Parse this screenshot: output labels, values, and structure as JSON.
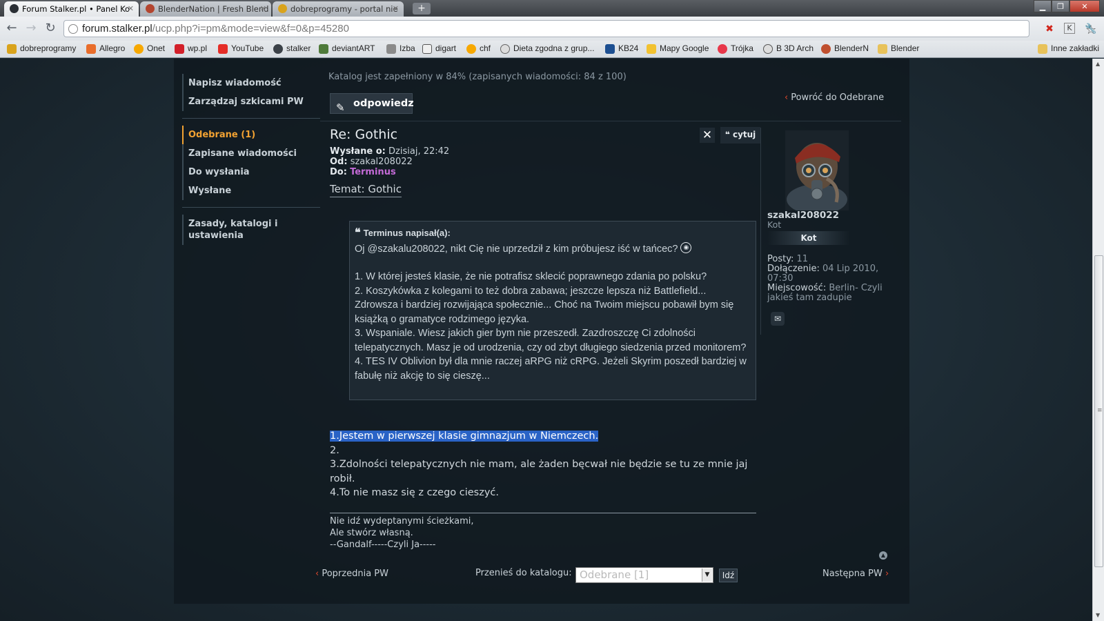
{
  "browser": {
    "tabs": [
      {
        "title": "Forum Stalker.pl • Panel Ko",
        "active": true
      },
      {
        "title": "BlenderNation | Fresh Blend",
        "active": false
      },
      {
        "title": "dobreprogramy - portal nie",
        "active": false
      }
    ],
    "url_host": "forum.stalker.pl",
    "url_path": "/ucp.php?i=pm&mode=view&f=0&p=45280",
    "bookmarks": [
      "dobreprogramy",
      "Allegro",
      "Onet",
      "wp.pl",
      "YouTube",
      "stalker",
      "deviantART",
      "Izba",
      "digart",
      "chf",
      "Dieta zgodna z grup...",
      "KB24",
      "Mapy Google",
      "Trójka",
      "B 3D Arch",
      "BlenderN",
      "Blender"
    ],
    "other_bookmarks": "Inne zakładki"
  },
  "menu": {
    "compose": "Napisz wiadomość",
    "drafts": "Zarządzaj szkicami PW",
    "inbox": "Odebrane (1)",
    "saved": "Zapisane wiadomości",
    "outbox": "Do wysłania",
    "sent": "Wysłane",
    "rules": "Zasady, katalogi i ustawienia"
  },
  "catalog_status": "Katalog jest zapełniony w 84% (zapisanych wiadomości: 84 z 100)",
  "reply_button": "odpowiedz",
  "back_link": "Powróć do Odebrane",
  "post": {
    "title": "Re: Gothic",
    "sent_label": "Wysłane o:",
    "sent_value": "Dzisiaj, 22:42",
    "from_label": "Od:",
    "from_value": "szakal208022",
    "to_label": "Do:",
    "to_value": "Terminus",
    "topic": "Temat: Gothic",
    "quote_button": "cytuj",
    "quote": {
      "header": "Terminus napisał(a):",
      "intro": "Oj @szakalu208022, nikt Cię nie uprzedził z kim próbujesz iść w tańcec?",
      "p1": "1. W której jesteś klasie, że nie potrafisz sklecić poprawnego zdania po polsku?",
      "p2": "2. Koszykówka z kolegami to też dobra zabawa; jeszcze lepsza niż Battlefield... Zdrowsza i bardziej rozwijająca społecznie... Choć na Twoim miejscu pobawił bym się książką o gramatyce rodzimego języka.",
      "p3": "3. Wspaniale. Wiesz jakich gier bym nie przeszedł. Zazdroszczę Ci zdolności telepatycznych. Masz je od urodzenia, czy od zbyt długiego siedzenia przed monitorem?",
      "p4": "4. TES IV Oblivion był dla mnie raczej aRPG niż cRPG. Jeżeli Skyrim poszedł bardziej w fabułę niż akcję to się cieszę..."
    },
    "reply": {
      "l1": "1.Jestem w pierwszej klasie gimnazjum w Niemczech.",
      "l2": "2.",
      "l3": "3.Zdolności telepatycznych nie mam, ale żaden bęcwał nie będzie se tu ze mnie jaj robił.",
      "l4": "4.To nie masz się z czego cieszyć."
    },
    "signature": [
      "Nie idź wydeptanymi ścieżkami,",
      "Ale stwórz własną.",
      "--Gandalf-----Czyli Ja-----"
    ]
  },
  "profile": {
    "username": "szakal208022",
    "rank": "Kot",
    "rank_badge": "Kot",
    "posts_label": "Posty:",
    "posts_value": "11",
    "joined_label": "Dołączenie:",
    "joined_value": "04 Lip 2010, 07:30",
    "location_label": "Miejscowość:",
    "location_value": "Berlin- Czyli jakieś tam zadupie"
  },
  "footer": {
    "prev": "Poprzednia PW",
    "move_label": "Przenieś do katalogu:",
    "folder_selected": "Odebrane [1]",
    "go": "Idź",
    "next": "Następna PW"
  },
  "colors": {
    "accent_orange": "#f2a232",
    "recipient_purple": "#c36ad6",
    "selection_blue": "#2a63c6",
    "arrow_red": "#e0482c"
  }
}
